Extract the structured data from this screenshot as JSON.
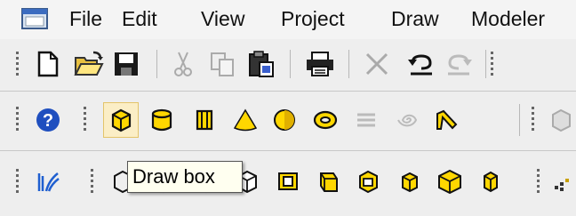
{
  "menu": {
    "items": [
      {
        "name": "menu-file",
        "label": "File"
      },
      {
        "name": "menu-edit",
        "label": "Edit"
      },
      {
        "name": "menu-view",
        "label": "View"
      },
      {
        "name": "menu-project",
        "label": "Project"
      },
      {
        "name": "menu-draw",
        "label": "Draw"
      },
      {
        "name": "menu-modeler",
        "label": "Modeler"
      }
    ]
  },
  "toolbar": {
    "standard_icons": [
      "new-file-icon",
      "open-folder-icon",
      "save-icon",
      "cut-icon",
      "copy-icon",
      "paste-icon",
      "print-icon",
      "delete-icon",
      "undo-icon",
      "redo-icon"
    ],
    "draw_icons": [
      "help-icon",
      "draw-box-icon",
      "draw-cylinder-icon",
      "draw-regular-polyhedron-icon",
      "draw-cone-icon",
      "draw-sphere-icon",
      "draw-torus-icon",
      "draw-helix-icon",
      "draw-spiral-icon",
      "draw-bondwire-icon"
    ],
    "modeler_icons": [
      "fields-icon",
      "edge-icon",
      "face-icon",
      "hollow-icon",
      "section-icon",
      "sweep-icon",
      "thicken-icon",
      "split-icon",
      "unite-icon",
      "separate-icon",
      "object-icon"
    ]
  },
  "tooltip": {
    "text": "Draw box"
  },
  "colors": {
    "accent_yellow": "#ffd700",
    "help_blue": "#1f4fbf",
    "active_bg": "#fbeec6"
  }
}
